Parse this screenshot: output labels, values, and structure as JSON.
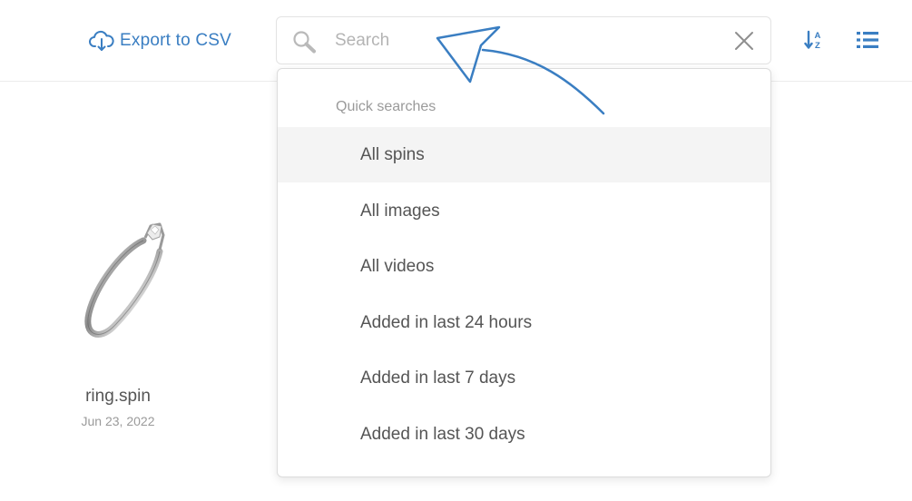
{
  "toolbar": {
    "export_label": "Export to CSV",
    "export_icon": "cloud-download-icon",
    "sort_icon": "sort-az-icon",
    "view_icon": "list-view-icon"
  },
  "search": {
    "placeholder": "Search",
    "value": "",
    "search_icon": "magnifier-icon",
    "clear_icon": "close-icon"
  },
  "quick_searches": {
    "heading": "Quick searches",
    "items": [
      {
        "label": "All spins",
        "highlighted": true
      },
      {
        "label": "All images",
        "highlighted": false
      },
      {
        "label": "All videos",
        "highlighted": false
      },
      {
        "label": "Added in last 24 hours",
        "highlighted": false
      },
      {
        "label": "Added in last 7 days",
        "highlighted": false
      },
      {
        "label": "Added in last 30 days",
        "highlighted": false
      }
    ]
  },
  "assets": [
    {
      "name": "ring.spin",
      "date": "Jun 23, 2022",
      "thumbnail": "ring-image"
    }
  ],
  "annotation": {
    "icon": "curved-arrow-icon"
  },
  "colors": {
    "accent": "#3a7ec2",
    "text": "#555555",
    "muted": "#9a9a9a",
    "highlight_bg": "#f4f4f4",
    "border": "#e3e3e3"
  }
}
